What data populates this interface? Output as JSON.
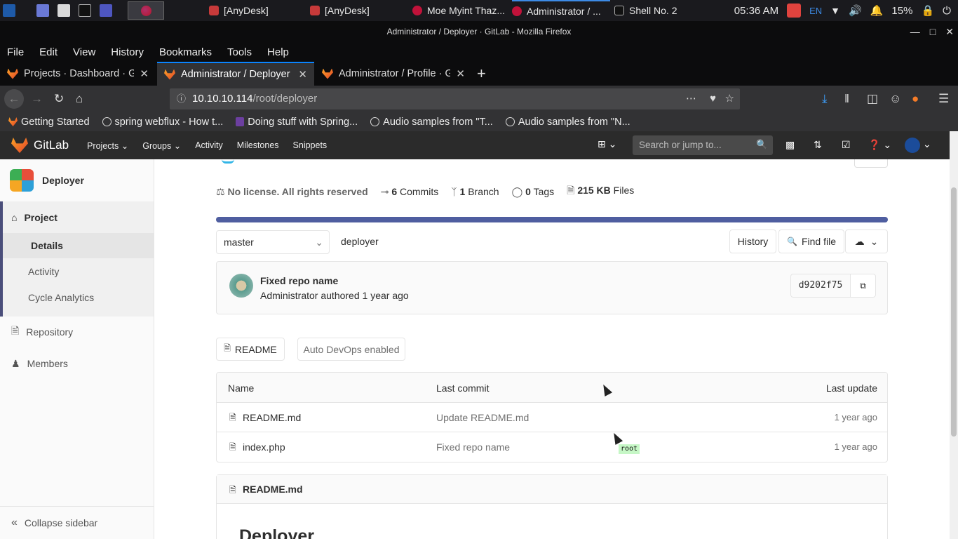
{
  "taskbar": {
    "tasks": [
      "[AnyDesk]",
      "[AnyDesk]",
      "Moe Myint Thaz...",
      "Administrator / ...",
      "Shell No. 2"
    ],
    "clock": "05:36 AM",
    "lang": "EN",
    "battery": "15%"
  },
  "window": {
    "title": "Administrator / Deployer · GitLab - Mozilla Firefox"
  },
  "menubar": [
    "File",
    "Edit",
    "View",
    "History",
    "Bookmarks",
    "Tools",
    "Help"
  ],
  "tabs": [
    {
      "label": "Projects · Dashboard · Git"
    },
    {
      "label": "Administrator / Deployer"
    },
    {
      "label": "Administrator / Profile · G"
    }
  ],
  "url": {
    "host": "10.10.10.114",
    "path": "/root/deployer"
  },
  "bookmarks": [
    "Getting Started",
    "spring webflux - How t...",
    "Doing stuff with Spring...",
    "Audio samples from \"T...",
    "Audio samples from \"N..."
  ],
  "gitlab": {
    "brand": "GitLab",
    "nav": [
      "Projects",
      "Groups",
      "Activity",
      "Milestones",
      "Snippets"
    ],
    "search_placeholder": "Search or jump to..."
  },
  "sidebar": {
    "project_name": "Deployer",
    "section": "Project",
    "sub_items": [
      "Details",
      "Activity",
      "Cycle Analytics"
    ],
    "items": [
      "Repository",
      "Members"
    ],
    "collapse": "Collapse sidebar"
  },
  "stats": {
    "license": "No license. All rights reserved",
    "commits_count": "6",
    "commits_label": "Commits",
    "branch_count": "1",
    "branch_label": "Branch",
    "tags_count": "0",
    "tags_label": "Tags",
    "files_size": "215 KB",
    "files_label": "Files"
  },
  "repo": {
    "branch": "master",
    "path": "deployer",
    "history_btn": "History",
    "find_file_btn": "Find file"
  },
  "commit": {
    "message": "Fixed repo name",
    "author": "Administrator",
    "authored": "authored 1 year ago",
    "sha": "d9202f75"
  },
  "buttons": {
    "readme": "README",
    "autodevops": "Auto DevOps enabled"
  },
  "files": {
    "headers": [
      "Name",
      "Last commit",
      "Last update"
    ],
    "rows": [
      {
        "name": "README.md",
        "commit": "Update README.md",
        "updated": "1 year ago"
      },
      {
        "name": "index.php",
        "commit": "Fixed repo name",
        "updated": "1 year ago"
      }
    ]
  },
  "tooltip": "root",
  "readme": {
    "filename": "README.md",
    "heading": "Deployer"
  }
}
